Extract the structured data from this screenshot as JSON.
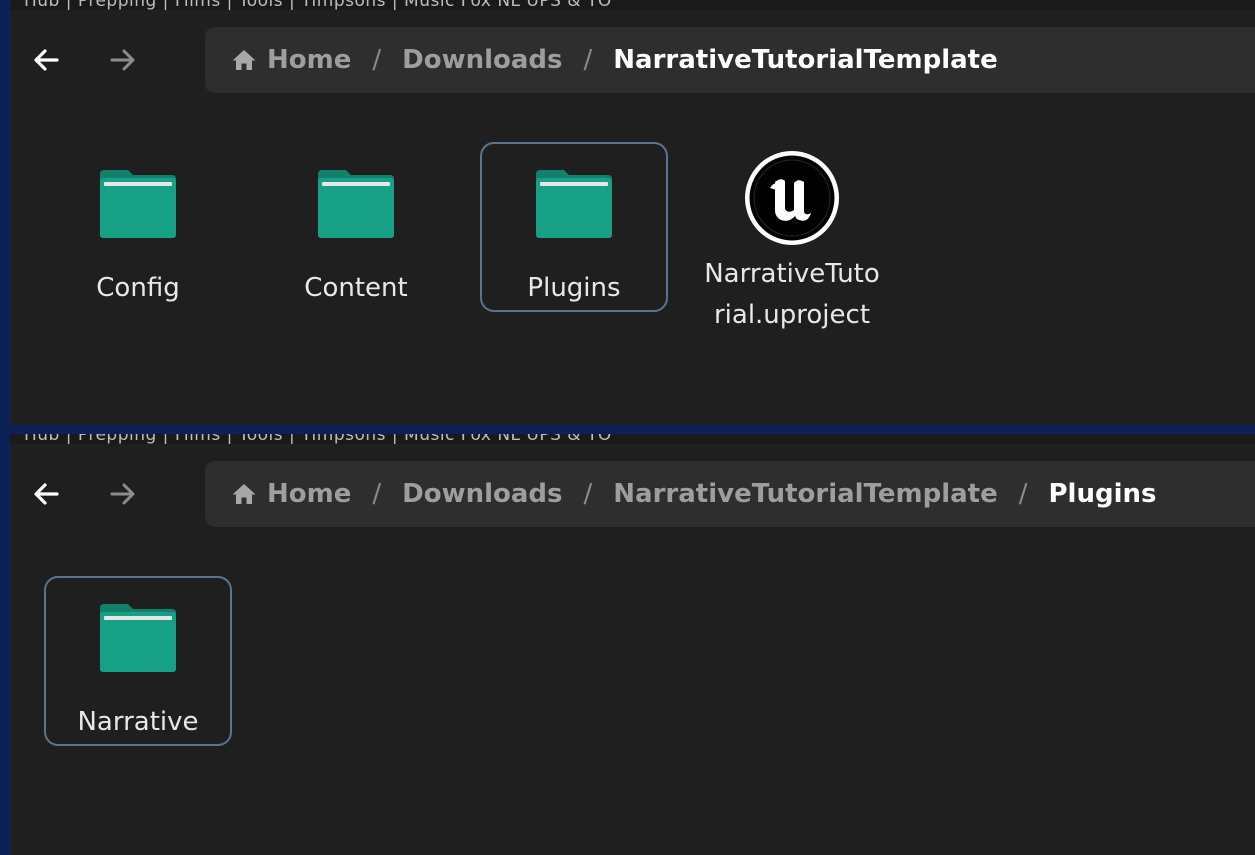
{
  "windows": [
    {
      "bookmarks_text": "Hub | Prepping | Films | Tools | Timpsons | Music  Fox  NL UPS & TO",
      "breadcrumb": {
        "home": "Home",
        "separator": "/",
        "items": [
          "Downloads",
          "NarrativeTutorialTemplate"
        ]
      },
      "files": [
        {
          "name": "Config",
          "type": "folder",
          "selected": false
        },
        {
          "name": "Content",
          "type": "folder",
          "selected": false
        },
        {
          "name": "Plugins",
          "type": "folder",
          "selected": true
        },
        {
          "name": "NarrativeTutorial.uproject",
          "type": "unreal-project",
          "selected": false
        }
      ]
    },
    {
      "bookmarks_text": "Hub | Prepping | Films | Tools | Timpsons | Music  Fox  NL UPS & TO",
      "breadcrumb": {
        "home": "Home",
        "separator": "/",
        "items": [
          "Downloads",
          "NarrativeTutorialTemplate",
          "Plugins"
        ]
      },
      "files": [
        {
          "name": "Narrative",
          "type": "folder",
          "selected": true
        }
      ]
    }
  ],
  "icons": {
    "back": "arrow-left-icon",
    "forward": "arrow-right-icon",
    "home": "home-icon",
    "folder": "folder-icon",
    "unreal": "unreal-engine-icon"
  },
  "colors": {
    "desktop": "#0a2258",
    "window_bg": "#1f1f1f",
    "breadcrumb_bg": "#2e2e2e",
    "folder_body": "#16a085",
    "folder_tab": "#12806b",
    "selection_border": "#5b7492"
  }
}
